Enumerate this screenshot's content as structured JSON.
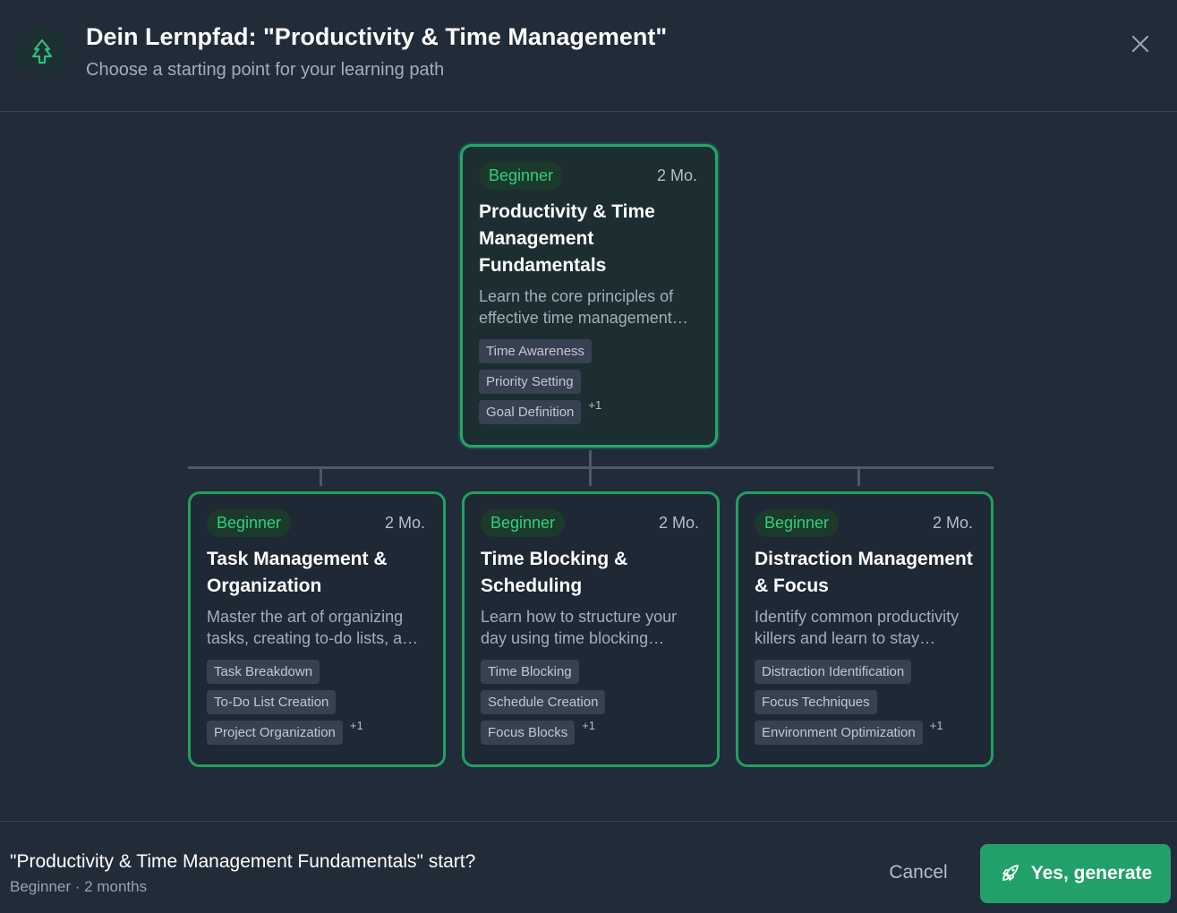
{
  "header": {
    "title": "Dein Lernpfad: \"Productivity & Time Management\"",
    "subtitle": "Choose a starting point for your learning path",
    "logo_icon": "tree-icon",
    "close_icon": "close-icon"
  },
  "colors": {
    "accent": "#22a06a",
    "background": "#222b38",
    "card_border": "#20a160",
    "badge_text": "#31d07a"
  },
  "root_card": {
    "level": "Beginner",
    "duration": "2 Mo.",
    "title": "Productivity & Time Management Fundamentals",
    "description": "Learn the core principles of effective time management and productivity",
    "tags": [
      "Time Awareness",
      "Priority Setting",
      "Goal Definition"
    ],
    "more": "+1"
  },
  "child_cards": [
    {
      "level": "Beginner",
      "duration": "2 Mo.",
      "title": "Task Management & Organization",
      "description": "Master the art of organizing tasks, creating to-do lists, and managing projects",
      "tags": [
        "Task Breakdown",
        "To-Do List Creation",
        "Project Organization"
      ],
      "more": "+1"
    },
    {
      "level": "Beginner",
      "duration": "2 Mo.",
      "title": "Time Blocking & Scheduling",
      "description": "Learn how to structure your day using time blocking techniques",
      "tags": [
        "Time Blocking",
        "Schedule Creation",
        "Focus Blocks"
      ],
      "more": "+1"
    },
    {
      "level": "Beginner",
      "duration": "2 Mo.",
      "title": "Distraction Management & Focus",
      "description": "Identify common productivity killers and learn to stay focused",
      "tags": [
        "Distraction Identification",
        "Focus Techniques",
        "Environment Optimization"
      ],
      "more": "+1"
    }
  ],
  "footer": {
    "question": "\"Productivity & Time Management Fundamentals\" start?",
    "meta": "Beginner · 2 months",
    "cancel_label": "Cancel",
    "generate_label": "Yes, generate",
    "generate_icon": "rocket-icon"
  }
}
